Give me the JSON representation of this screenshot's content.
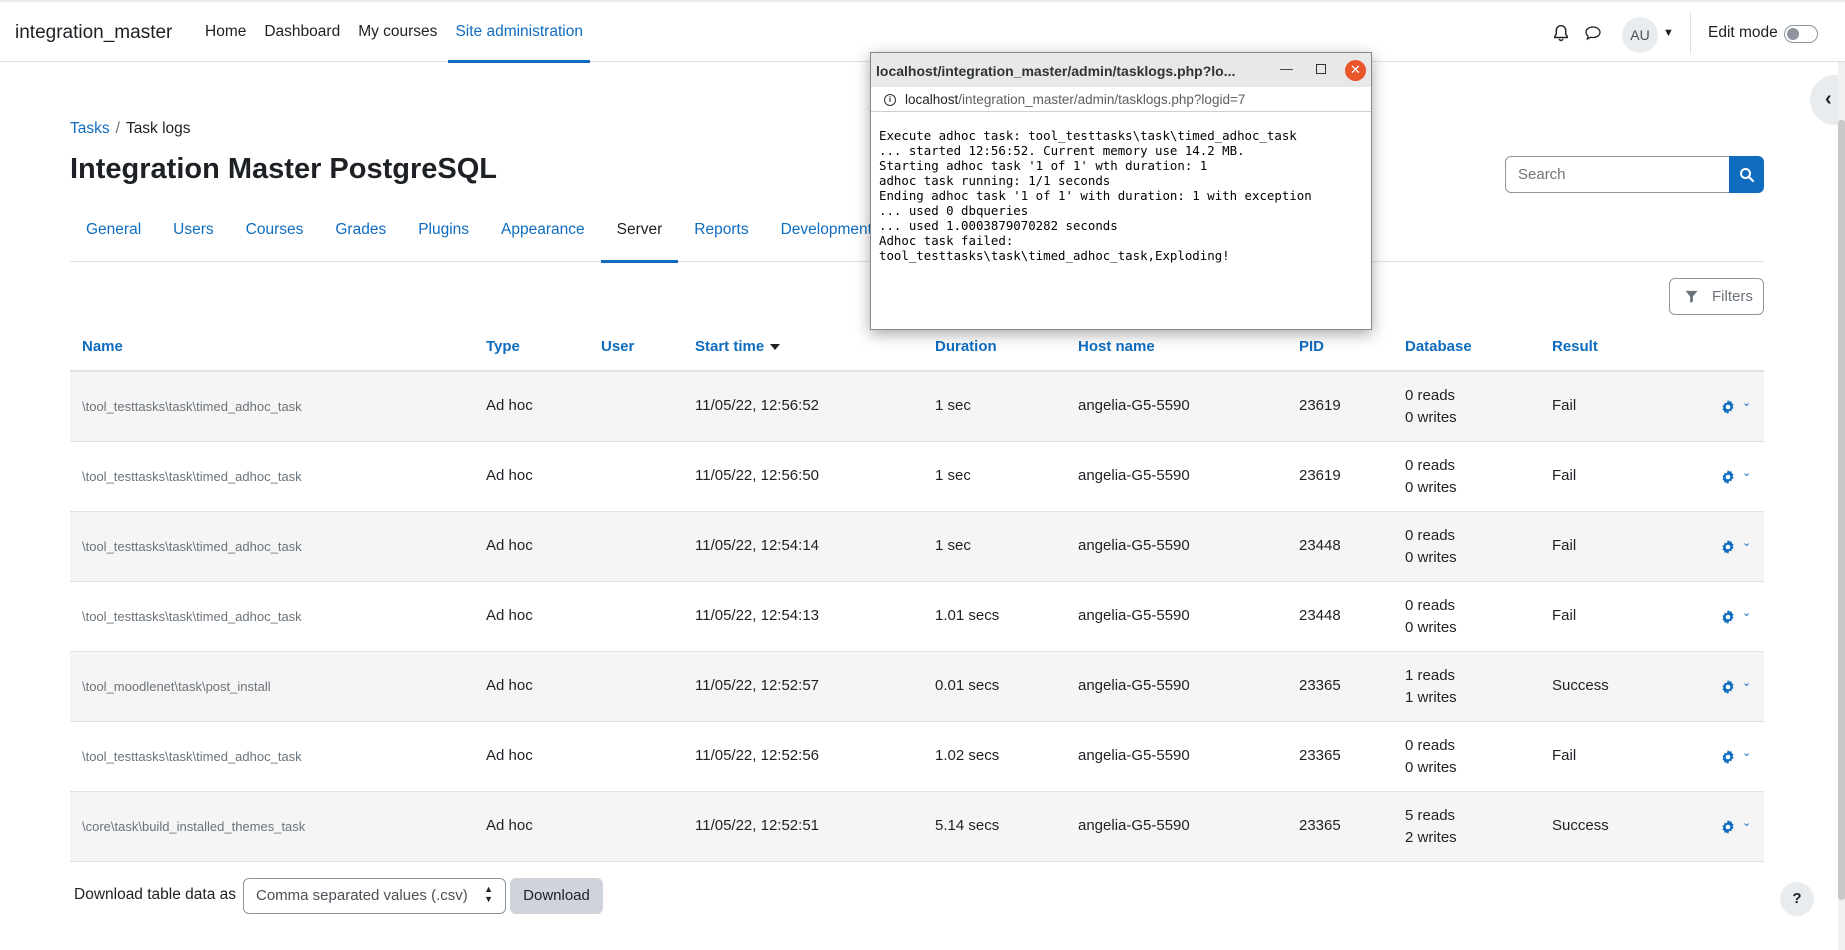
{
  "navbar": {
    "brand": "integration_master",
    "links": [
      "Home",
      "Dashboard",
      "My courses",
      "Site administration"
    ],
    "avatar_initials": "AU",
    "edit_mode_label": "Edit mode"
  },
  "breadcrumb": {
    "parent": "Tasks",
    "current": "Task logs"
  },
  "page_title": "Integration Master PostgreSQL",
  "search": {
    "placeholder": "Search"
  },
  "tabs": [
    "General",
    "Users",
    "Courses",
    "Grades",
    "Plugins",
    "Appearance",
    "Server",
    "Reports",
    "Development"
  ],
  "active_tab": "Server",
  "filters_label": "Filters",
  "table": {
    "headers": {
      "name": "Name",
      "type": "Type",
      "user": "User",
      "start_time": "Start time",
      "duration": "Duration",
      "host_name": "Host name",
      "pid": "PID",
      "database": "Database",
      "result": "Result"
    },
    "rows": [
      {
        "name": "\\tool_testtasks\\task\\timed_adhoc_task",
        "type": "Ad hoc",
        "user": "",
        "start_time": "11/05/22, 12:56:52",
        "duration": "1 sec",
        "host": "angelia-G5-5590",
        "pid": "23619",
        "reads": "0 reads",
        "writes": "0 writes",
        "result": "Fail"
      },
      {
        "name": "\\tool_testtasks\\task\\timed_adhoc_task",
        "type": "Ad hoc",
        "user": "",
        "start_time": "11/05/22, 12:56:50",
        "duration": "1 sec",
        "host": "angelia-G5-5590",
        "pid": "23619",
        "reads": "0 reads",
        "writes": "0 writes",
        "result": "Fail"
      },
      {
        "name": "\\tool_testtasks\\task\\timed_adhoc_task",
        "type": "Ad hoc",
        "user": "",
        "start_time": "11/05/22, 12:54:14",
        "duration": "1 sec",
        "host": "angelia-G5-5590",
        "pid": "23448",
        "reads": "0 reads",
        "writes": "0 writes",
        "result": "Fail"
      },
      {
        "name": "\\tool_testtasks\\task\\timed_adhoc_task",
        "type": "Ad hoc",
        "user": "",
        "start_time": "11/05/22, 12:54:13",
        "duration": "1.01 secs",
        "host": "angelia-G5-5590",
        "pid": "23448",
        "reads": "0 reads",
        "writes": "0 writes",
        "result": "Fail"
      },
      {
        "name": "\\tool_moodlenet\\task\\post_install",
        "type": "Ad hoc",
        "user": "",
        "start_time": "11/05/22, 12:52:57",
        "duration": "0.01 secs",
        "host": "angelia-G5-5590",
        "pid": "23365",
        "reads": "1 reads",
        "writes": "1 writes",
        "result": "Success"
      },
      {
        "name": "\\tool_testtasks\\task\\timed_adhoc_task",
        "type": "Ad hoc",
        "user": "",
        "start_time": "11/05/22, 12:52:56",
        "duration": "1.02 secs",
        "host": "angelia-G5-5590",
        "pid": "23365",
        "reads": "0 reads",
        "writes": "0 writes",
        "result": "Fail"
      },
      {
        "name": "\\core\\task\\build_installed_themes_task",
        "type": "Ad hoc",
        "user": "",
        "start_time": "11/05/22, 12:52:51",
        "duration": "5.14 secs",
        "host": "angelia-G5-5590",
        "pid": "23365",
        "reads": "5 reads",
        "writes": "2 writes",
        "result": "Success"
      }
    ]
  },
  "download": {
    "label": "Download table data as",
    "format": "Comma separated values (.csv)",
    "button": "Download"
  },
  "help_label": "?",
  "popup": {
    "title": "localhost/integration_master/admin/tasklogs.php?lo...",
    "url_host": "localhost",
    "url_path": "/integration_master/admin/tasklogs.php?logid=7",
    "log_lines": [
      "Execute adhoc task: tool_testtasks\\task\\timed_adhoc_task",
      "... started 12:56:52. Current memory use 14.2 MB.",
      "Starting adhoc task '1 of 1' wth duration: 1",
      "adhoc task running: 1/1 seconds",
      "Ending adhoc task '1 of 1' with duration: 1 with exception",
      "... used 0 dbqueries",
      "... used 1.0003879070282 seconds",
      "Adhoc task failed:",
      "tool_testtasks\\task\\timed_adhoc_task,Exploding!"
    ]
  },
  "colors": {
    "link": "#0f6cbf",
    "close": "#e8562a"
  }
}
